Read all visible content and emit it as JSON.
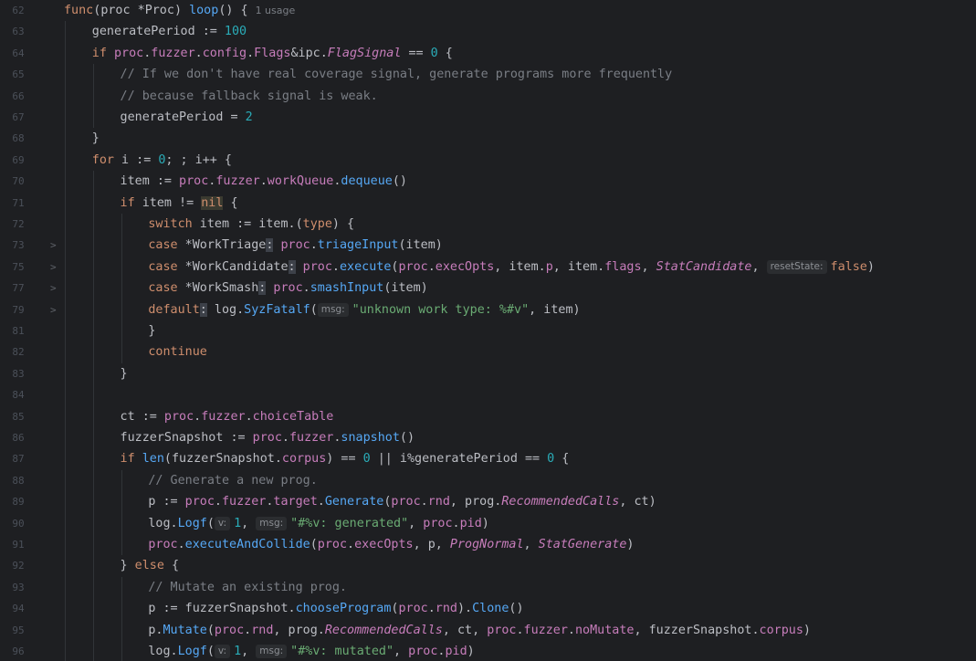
{
  "editor": {
    "usage_hint": "1 usage",
    "lines": [
      {
        "num": "62",
        "fold": ""
      },
      {
        "num": "63",
        "fold": ""
      },
      {
        "num": "64",
        "fold": ""
      },
      {
        "num": "65",
        "fold": ""
      },
      {
        "num": "66",
        "fold": ""
      },
      {
        "num": "67",
        "fold": ""
      },
      {
        "num": "68",
        "fold": ""
      },
      {
        "num": "69",
        "fold": ""
      },
      {
        "num": "70",
        "fold": ""
      },
      {
        "num": "71",
        "fold": ""
      },
      {
        "num": "72",
        "fold": ""
      },
      {
        "num": "73",
        "fold": ">"
      },
      {
        "num": "75",
        "fold": ">"
      },
      {
        "num": "77",
        "fold": ">"
      },
      {
        "num": "79",
        "fold": ">"
      },
      {
        "num": "81",
        "fold": ""
      },
      {
        "num": "82",
        "fold": ""
      },
      {
        "num": "83",
        "fold": ""
      },
      {
        "num": "84",
        "fold": ""
      },
      {
        "num": "85",
        "fold": ""
      },
      {
        "num": "86",
        "fold": ""
      },
      {
        "num": "87",
        "fold": ""
      },
      {
        "num": "88",
        "fold": ""
      },
      {
        "num": "89",
        "fold": ""
      },
      {
        "num": "90",
        "fold": ""
      },
      {
        "num": "91",
        "fold": ""
      },
      {
        "num": "92",
        "fold": ""
      },
      {
        "num": "93",
        "fold": ""
      },
      {
        "num": "94",
        "fold": ""
      },
      {
        "num": "95",
        "fold": ""
      },
      {
        "num": "96",
        "fold": ""
      }
    ],
    "tokens": {
      "l62": [
        "func",
        "(",
        "proc",
        " *",
        "Proc",
        ") ",
        "loop",
        "() {"
      ],
      "l63": [
        "generatePeriod",
        " := ",
        "100"
      ],
      "l64": [
        "if ",
        "proc",
        ".",
        "fuzzer",
        ".",
        "config",
        ".",
        "Flags",
        "&",
        "ipc",
        ".",
        "FlagSignal",
        " == ",
        "0",
        " {"
      ],
      "l65": "// If we don't have real coverage signal, generate programs more frequently",
      "l66": "// because fallback signal is weak.",
      "l67": [
        "generatePeriod",
        " = ",
        "2"
      ],
      "l68": "}",
      "l69": [
        "for ",
        "i",
        " := ",
        "0",
        "; ; ",
        "i",
        "++ {"
      ],
      "l70": [
        "item",
        " := ",
        "proc",
        ".",
        "fuzzer",
        ".",
        "workQueue",
        ".",
        "dequeue",
        "()"
      ],
      "l71": [
        "if ",
        "item",
        " != ",
        "nil",
        " {"
      ],
      "l72": [
        "switch ",
        "item",
        " := ",
        "item",
        ".(",
        "type",
        ") {"
      ],
      "l73": [
        "case ",
        "*WorkTriage",
        ":",
        " ",
        "proc",
        ".",
        "triageInput",
        "(",
        "item",
        ")"
      ],
      "l75": [
        "case ",
        "*WorkCandidate",
        ":",
        " ",
        "proc",
        ".",
        "execute",
        "(",
        "proc",
        ".",
        "execOpts",
        ", ",
        "item",
        ".",
        "p",
        ", ",
        "item",
        ".",
        "flags",
        ", ",
        "StatCandidate",
        ", ",
        "resetState:",
        "false",
        ")"
      ],
      "l77": [
        "case ",
        "*WorkSmash",
        ":",
        " ",
        "proc",
        ".",
        "smashInput",
        "(",
        "item",
        ")"
      ],
      "l79": [
        "default",
        ":",
        " ",
        "log",
        ".",
        "SyzFatalf",
        "(",
        "msg:",
        "\"unknown work type: %#v\"",
        ", ",
        "item",
        ")"
      ],
      "l81": "}",
      "l82": "continue",
      "l83": "}",
      "l85": [
        "ct",
        " := ",
        "proc",
        ".",
        "fuzzer",
        ".",
        "choiceTable"
      ],
      "l86": [
        "fuzzerSnapshot",
        " := ",
        "proc",
        ".",
        "fuzzer",
        ".",
        "snapshot",
        "()"
      ],
      "l87": [
        "if ",
        "len",
        "(",
        "fuzzerSnapshot",
        ".",
        "corpus",
        ") == ",
        "0",
        " || ",
        "i",
        "%",
        "generatePeriod",
        " == ",
        "0",
        " {"
      ],
      "l88": "// Generate a new prog.",
      "l89": [
        "p",
        " := ",
        "proc",
        ".",
        "fuzzer",
        ".",
        "target",
        ".",
        "Generate",
        "(",
        "proc",
        ".",
        "rnd",
        ", ",
        "prog",
        ".",
        "RecommendedCalls",
        ", ",
        "ct",
        ")"
      ],
      "l90": [
        "log",
        ".",
        "Logf",
        "(",
        "v:",
        "1",
        ", ",
        "msg:",
        "\"#%v: generated\"",
        ", ",
        "proc",
        ".",
        "pid",
        ")"
      ],
      "l91": [
        "proc",
        ".",
        "executeAndCollide",
        "(",
        "proc",
        ".",
        "execOpts",
        ", ",
        "p",
        ", ",
        "ProgNormal",
        ", ",
        "StatGenerate",
        ")"
      ],
      "l92": [
        "} ",
        "else",
        " {"
      ],
      "l93": "// Mutate an existing prog.",
      "l94": [
        "p",
        " := ",
        "fuzzerSnapshot",
        ".",
        "chooseProgram",
        "(",
        "proc",
        ".",
        "rnd",
        ").",
        "Clone",
        "()"
      ],
      "l95": [
        "p",
        ".",
        "Mutate",
        "(",
        "proc",
        ".",
        "rnd",
        ", ",
        "prog",
        ".",
        "RecommendedCalls",
        ", ",
        "ct",
        ", ",
        "proc",
        ".",
        "fuzzer",
        ".",
        "noMutate",
        ", ",
        "fuzzerSnapshot",
        ".",
        "corpus",
        ")"
      ],
      "l96": [
        "log",
        ".",
        "Logf",
        "(",
        "v:",
        "1",
        ", ",
        "msg:",
        "\"#%v: mutated\"",
        ", ",
        "proc",
        ".",
        "pid",
        ")"
      ]
    }
  }
}
